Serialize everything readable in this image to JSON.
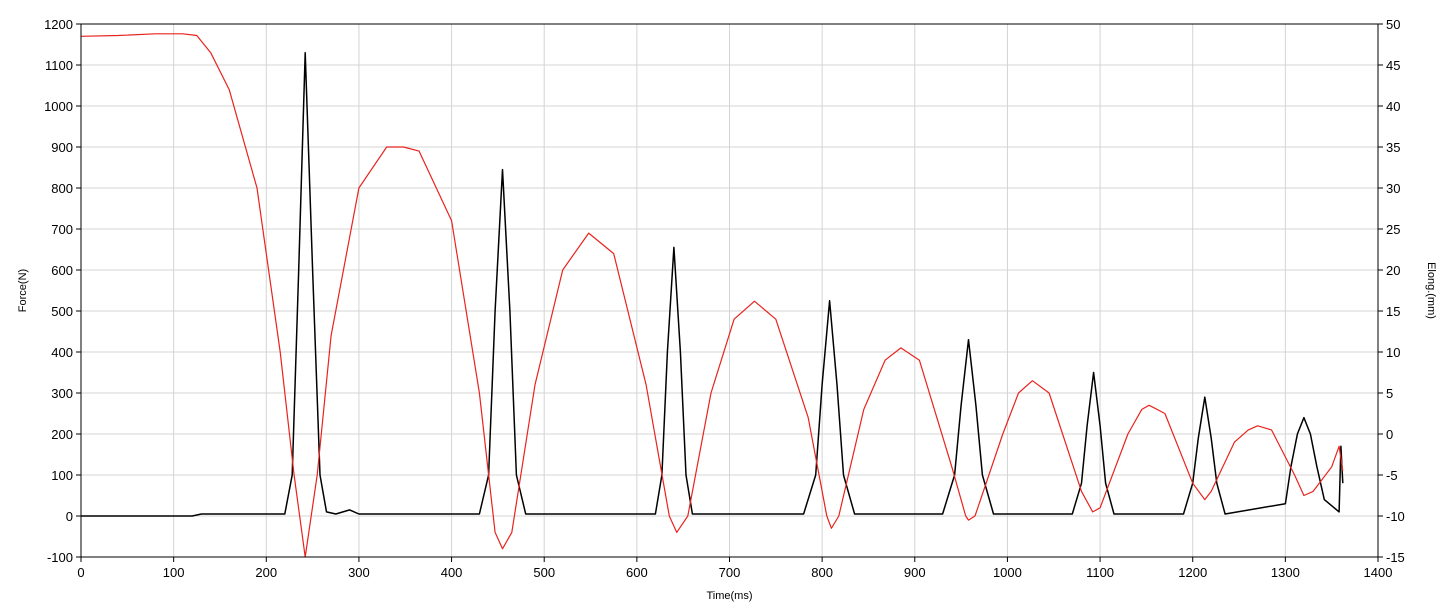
{
  "chart_data": {
    "type": "line",
    "title": "",
    "xlabel": "Time(ms)",
    "ylabel": "Force(N)",
    "y2label": "Elong.(mm)",
    "xlim": [
      0,
      1400
    ],
    "ylim": [
      -100,
      1200
    ],
    "y2lim": [
      -15,
      50
    ],
    "x_ticks": [
      0,
      100,
      200,
      300,
      400,
      500,
      600,
      700,
      800,
      900,
      1000,
      1100,
      1200,
      1300,
      1400
    ],
    "y_ticks": [
      -100,
      0,
      100,
      200,
      300,
      400,
      500,
      600,
      700,
      800,
      900,
      1000,
      1100,
      1200
    ],
    "y2_ticks": [
      -15,
      -10,
      -5,
      0,
      5,
      10,
      15,
      20,
      25,
      30,
      35,
      40,
      45,
      50
    ],
    "grid": true,
    "legend": "none",
    "series": [
      {
        "axis": "left",
        "color": "#000000",
        "x": [
          0,
          120,
          130,
          220,
          228,
          235,
          242,
          250,
          258,
          265,
          275,
          290,
          300,
          430,
          440,
          447,
          455,
          463,
          470,
          480,
          620,
          627,
          633,
          640,
          647,
          653,
          660,
          780,
          793,
          800,
          808,
          816,
          823,
          835,
          930,
          943,
          950,
          958,
          966,
          973,
          985,
          1070,
          1080,
          1086,
          1093,
          1100,
          1106,
          1115,
          1190,
          1200,
          1206,
          1213,
          1220,
          1226,
          1235,
          1300,
          1306,
          1313,
          1320,
          1327,
          1334,
          1342,
          1358,
          1360,
          1362
        ],
        "y": [
          0,
          0,
          5,
          5,
          100,
          600,
          1130,
          600,
          100,
          10,
          5,
          15,
          5,
          5,
          100,
          500,
          845,
          500,
          100,
          5,
          5,
          100,
          400,
          655,
          400,
          100,
          5,
          5,
          100,
          320,
          525,
          320,
          100,
          5,
          5,
          100,
          270,
          430,
          270,
          100,
          5,
          5,
          80,
          220,
          350,
          220,
          80,
          5,
          5,
          80,
          190,
          290,
          190,
          80,
          5,
          30,
          120,
          200,
          240,
          200,
          120,
          40,
          10,
          170,
          80
        ]
      },
      {
        "axis": "right",
        "color": "#e8231e",
        "x": [
          0,
          40,
          80,
          110,
          125,
          140,
          160,
          190,
          215,
          230,
          242,
          255,
          270,
          300,
          330,
          348,
          365,
          400,
          430,
          447,
          455,
          465,
          490,
          520,
          548,
          575,
          610,
          635,
          643,
          655,
          680,
          705,
          727,
          750,
          785,
          805,
          810,
          818,
          845,
          868,
          885,
          905,
          940,
          955,
          958,
          965,
          995,
          1012,
          1027,
          1045,
          1080,
          1092,
          1100,
          1130,
          1145,
          1153,
          1170,
          1200,
          1213,
          1220,
          1245,
          1260,
          1270,
          1285,
          1310,
          1320,
          1330,
          1350,
          1358,
          1362
        ],
        "y": [
          48.5,
          48.6,
          48.8,
          48.8,
          48.6,
          46.5,
          42,
          30,
          10,
          -5,
          -15,
          -5,
          12,
          30,
          35,
          35,
          34.5,
          26,
          5,
          -12,
          -14,
          -12,
          6,
          20,
          24.5,
          22,
          6,
          -10,
          -12,
          -10,
          5,
          14,
          16.2,
          14,
          2,
          -10,
          -11.5,
          -10,
          3,
          9,
          10.5,
          9,
          -4,
          -10,
          -10.5,
          -10,
          0,
          5,
          6.5,
          5,
          -7,
          -9.5,
          -9,
          0,
          3,
          3.5,
          2.5,
          -6,
          -8,
          -7,
          -1,
          0.5,
          1,
          0.5,
          -5,
          -7.5,
          -7,
          -4,
          -1.5,
          -4.5
        ]
      }
    ]
  }
}
